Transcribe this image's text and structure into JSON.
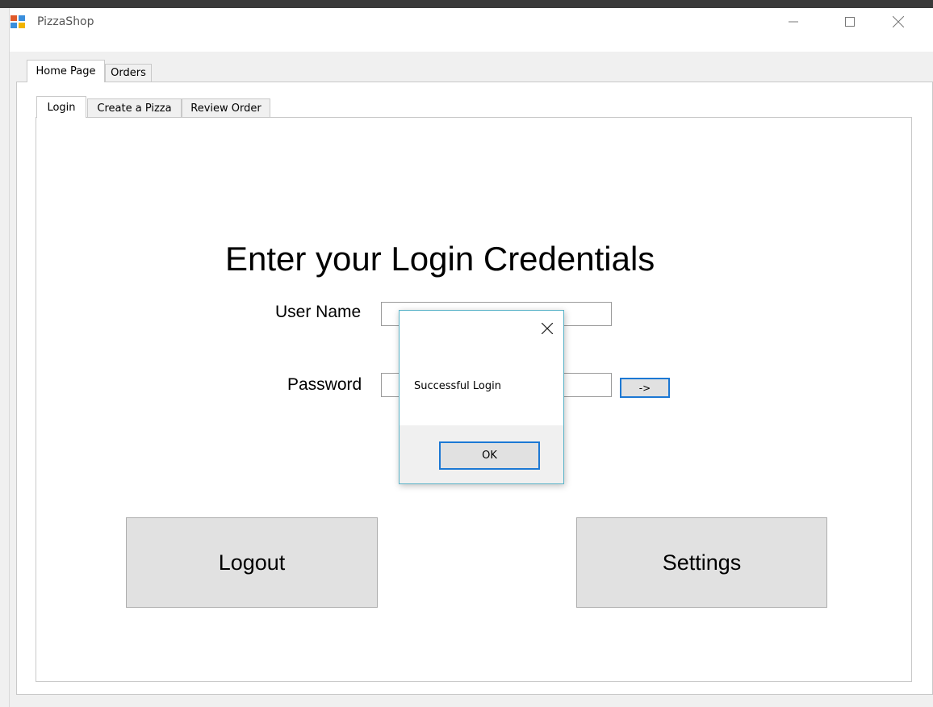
{
  "window": {
    "title": "PizzaShop",
    "app_icon": "winforms-app-icon",
    "controls": [
      "minimize-icon",
      "maximize-icon",
      "close-icon"
    ]
  },
  "outer_tabs": [
    {
      "label": "Home Page",
      "active": true
    },
    {
      "label": "Orders",
      "active": false
    }
  ],
  "inner_tabs": [
    {
      "label": "Login",
      "active": true
    },
    {
      "label": "Create a Pizza",
      "active": false
    },
    {
      "label": "Review Order",
      "active": false
    }
  ],
  "login": {
    "heading": "Enter your Login Credentials",
    "username_label": "User Name",
    "username_value": "",
    "password_label": "Password",
    "password_value": "",
    "submit_label": "->"
  },
  "buttons": {
    "logout": "Logout",
    "settings": "Settings"
  },
  "dialog": {
    "message": "Successful Login",
    "ok_label": "OK"
  },
  "colors": {
    "focus_border": "#1c78d4",
    "dialog_border": "#5ab3c8",
    "button_face": "#e1e1e1"
  }
}
